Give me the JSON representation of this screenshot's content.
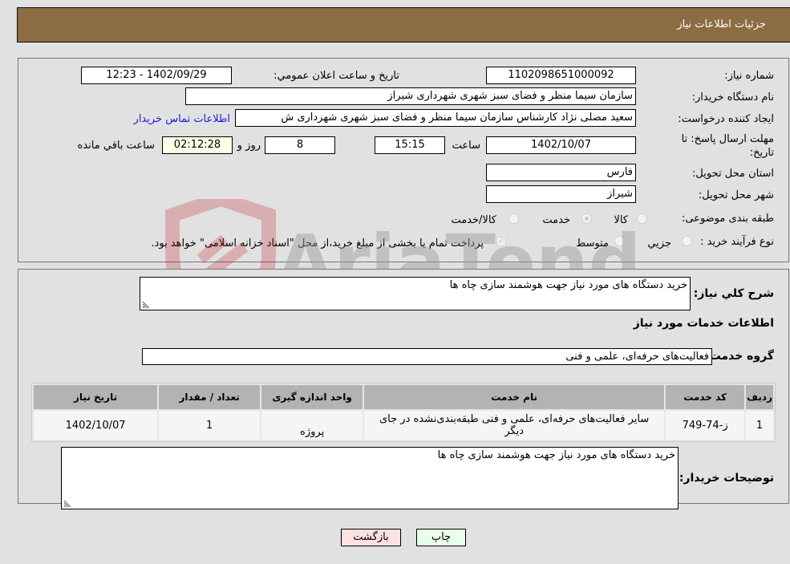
{
  "header": {
    "title": "جزئیات اطلاعات نیاز"
  },
  "fields": {
    "need_number": {
      "label": "شماره نیاز:",
      "value": "1102098651000092"
    },
    "announce_datetime": {
      "label": "تاریخ و ساعت اعلان عمومي:",
      "value": "1402/09/29 - 12:23"
    },
    "buyer_org": {
      "label": "نام دستگاه خریدار:",
      "value": "سازمان سیما منظر و فضای سبز شهری شهرداری شیراز"
    },
    "requester": {
      "label": "ایجاد کننده درخواست:",
      "value": "سعید مصلی نژاد کارشناس سازمان سیما منظر و فضای سبز شهری شهرداری ش"
    },
    "buyer_contact_link": "اطلاعات تماس خریدار",
    "deadline": {
      "label": "مهلت ارسال پاسخ: تا تاریخ:",
      "date": "1402/10/07",
      "time_label": "ساعت",
      "time": "15:15",
      "days": "8",
      "days_label": "روز و",
      "remaining": "02:12:28",
      "remaining_label": "ساعت باقي مانده"
    },
    "province": {
      "label": "استان محل تحویل:",
      "value": "فارس"
    },
    "city": {
      "label": "شهر محل تحویل:",
      "value": "شیراز"
    },
    "category": {
      "label": "طبقه بندی موضوعی:",
      "options": [
        "کالا",
        "خدمت",
        "کالا/خدمت"
      ],
      "selected": "خدمت"
    },
    "process_type": {
      "label": "نوع فرآیند خرید :",
      "options": [
        "جزيي",
        "متوسط"
      ],
      "payment_note": "پرداخت تمام یا بخشی از مبلغ خرید،از محل \"اسناد خزانه اسلامی\" خواهد بود."
    }
  },
  "description": {
    "label": "شرح کلي نیاز:",
    "value": "خرید دستگاه های مورد نیاز جهت هوشمند سازی چاه ها"
  },
  "services_section": {
    "title": "اطلاعات خدمات مورد نیاز",
    "group_label": "گروه خدمت:",
    "group_value": "فعالیت‌های حرفه‌ای، علمی و فنی"
  },
  "table": {
    "headers": [
      "ردیف",
      "کد خدمت",
      "نام خدمت",
      "واحد اندازه گیری",
      "تعداد / مقدار",
      "تاریخ نیاز"
    ],
    "rows": [
      [
        "1",
        "ز-74-749",
        "سایر فعالیت‌های حرفه‌ای، علمی و فنی طبقه‌بندی‌نشده در جای دیگر",
        "پروژه",
        "1",
        "1402/10/07"
      ]
    ]
  },
  "buyer_notes": {
    "label": "توضیحات خریدار:",
    "value": "خرید دستگاه های مورد نیاز جهت هوشمند سازی چاه ها"
  },
  "buttons": {
    "print": "چاپ",
    "back": "بازگشت"
  },
  "watermark": {
    "text": "AriaTender.neT"
  },
  "colors": {
    "header_bg": "#8c6c42",
    "link": "#1a1adb",
    "back_btn": "#ffe1e1",
    "print_btn": "#eaffea"
  }
}
